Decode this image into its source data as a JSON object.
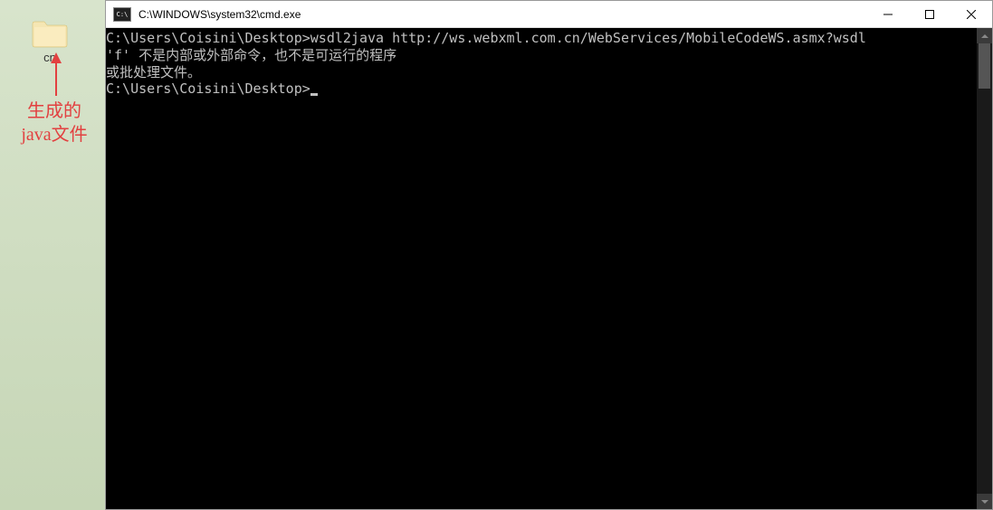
{
  "desktop": {
    "folder_label": "cn",
    "annotation_line1": "生成的",
    "annotation_line2": "java文件"
  },
  "window": {
    "title": "C:\\WINDOWS\\system32\\cmd.exe"
  },
  "terminal": {
    "line1": "C:\\Users\\Coisini\\Desktop>wsdl2java http://ws.webxml.com.cn/WebServices/MobileCodeWS.asmx?wsdl",
    "line2": "'f' 不是内部或外部命令，也不是可运行的程序",
    "line3": "或批处理文件。",
    "line4": "",
    "prompt": "C:\\Users\\Coisini\\Desktop>"
  }
}
